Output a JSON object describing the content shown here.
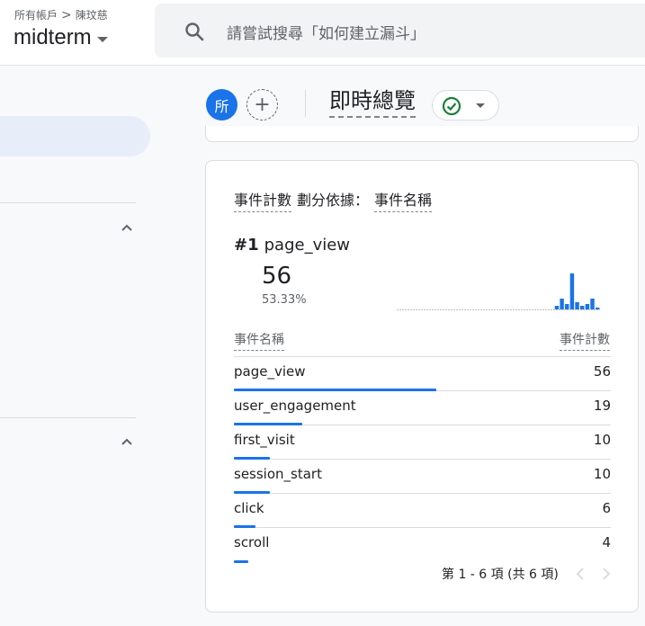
{
  "header": {
    "breadcrumb_all": "所有帳戶",
    "breadcrumb_account": "陳玟慈",
    "property_name": "midterm",
    "search_placeholder": "請嘗試搜尋「如何建立漏斗」"
  },
  "toolbar": {
    "avatar_letter": "所",
    "add_label": "+",
    "page_title": "即時總覽",
    "status_icon": "check-circle-icon"
  },
  "card": {
    "title_metric": "事件計數",
    "title_by": "劃分依據：",
    "title_dimension": "事件名稱",
    "top_rank": "#1",
    "top_name": "page_view",
    "top_value": "56",
    "top_percent": "53.33%",
    "sparkline": [
      0,
      0,
      0,
      0,
      0,
      0,
      0,
      0,
      0,
      0,
      0,
      0,
      0,
      0,
      0,
      0,
      0,
      0,
      0,
      0,
      0,
      0,
      0,
      0,
      0,
      0,
      0,
      0,
      0,
      0,
      0,
      0.1,
      0.3,
      0.15,
      1.0,
      0.2,
      0.1,
      0.15,
      0.3,
      0.05
    ],
    "col_name_header": "事件名稱",
    "col_count_header": "事件計數",
    "rows": [
      {
        "name": "page_view",
        "count": "56",
        "value": 56
      },
      {
        "name": "user_engagement",
        "count": "19",
        "value": 19
      },
      {
        "name": "first_visit",
        "count": "10",
        "value": 10
      },
      {
        "name": "session_start",
        "count": "10",
        "value": 10
      },
      {
        "name": "click",
        "count": "6",
        "value": 6
      },
      {
        "name": "scroll",
        "count": "4",
        "value": 4
      }
    ],
    "pager_text": "第 1 - 6 項 (共 6 項)"
  },
  "colors": {
    "accent": "#1a73e8",
    "ok_green": "#188038"
  }
}
